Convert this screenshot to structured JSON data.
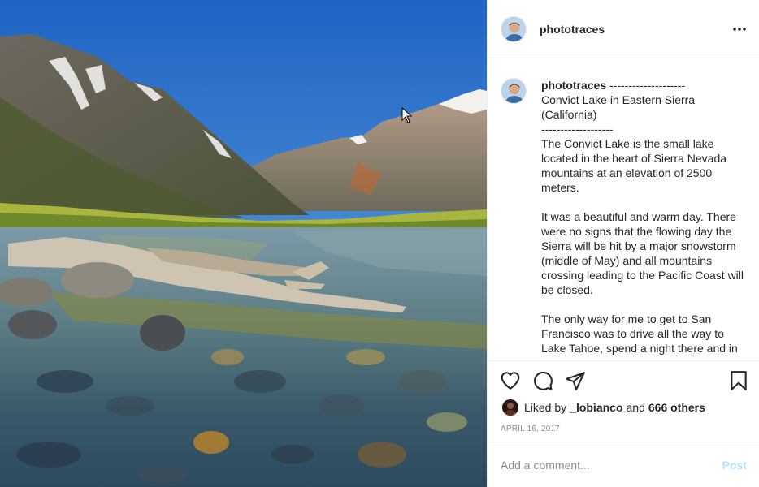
{
  "post": {
    "username": "phototraces",
    "caption": " --------------------\nConvict Lake in Eastern Sierra (California)\n-------------------\nThe Convict Lake is the small lake located in the heart of Sierra Nevada mountains at an elevation of 2500 meters.\n\nIt was a beautiful and warm day. There were no signs that the flowing day the Sierra will be hit by a major snowstorm (middle of May) and all mountains crossing leading to the Pacific Coast will be closed.\n\nThe only way for me to get to San Francisco was to drive all the way to Lake Tahoe, spend a night there and in",
    "date": "APRIL 16, 2017"
  },
  "likes": {
    "prefix": "Liked by",
    "user": "_lobianco",
    "joiner": "and",
    "others": "666 others"
  },
  "comment_box": {
    "placeholder": "Add a comment...",
    "post_label": "Post"
  },
  "icons": {
    "more": "more-options-icon",
    "like": "heart-icon",
    "comment": "comment-bubble-icon",
    "share": "paper-plane-icon",
    "save": "bookmark-icon"
  },
  "colors": {
    "text": "#262626",
    "muted": "#8e8e8e",
    "post_disabled": "#b2dffc",
    "divider": "#efefef"
  }
}
